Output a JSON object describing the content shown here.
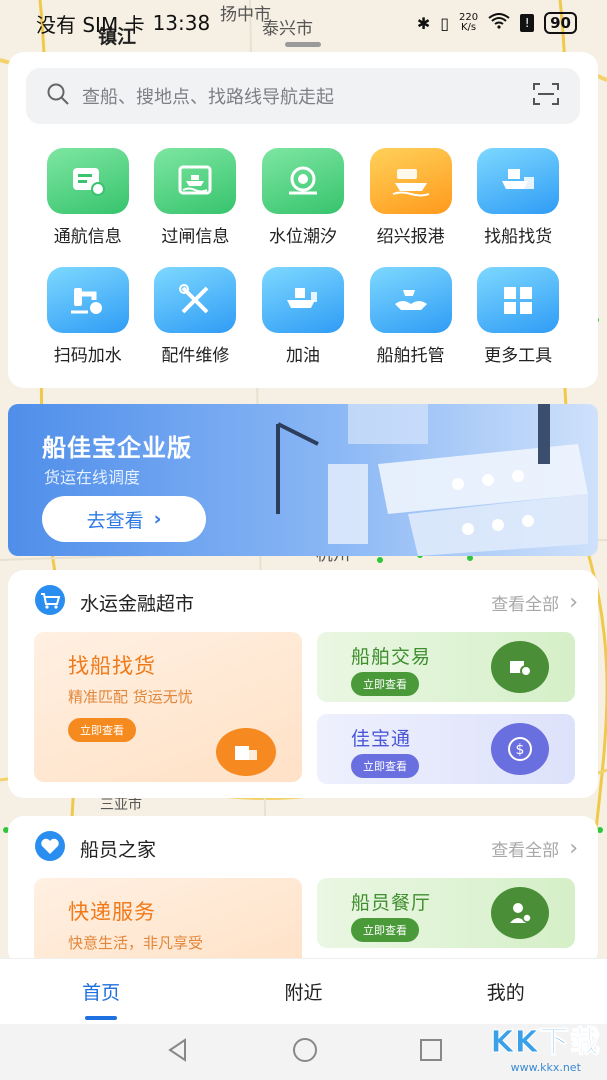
{
  "status_bar": {
    "carrier": "没有 SIM 卡",
    "time": "13:38",
    "speed_value": "220",
    "speed_unit": "K/s",
    "battery": "90"
  },
  "map": {
    "labels": [
      "扬中市",
      "泰兴市",
      "镇江",
      "杭州",
      "三亚市"
    ]
  },
  "search": {
    "placeholder": "查船、搜地点、找路线导航走起"
  },
  "tools": [
    {
      "label": "通航信息",
      "icon": "notice-board-icon",
      "color": "green"
    },
    {
      "label": "过闸信息",
      "icon": "ship-lock-icon",
      "color": "green"
    },
    {
      "label": "水位潮汐",
      "icon": "water-level-icon",
      "color": "green"
    },
    {
      "label": "绍兴报港",
      "icon": "port-report-icon",
      "color": "orange"
    },
    {
      "label": "找船找货",
      "icon": "cargo-ship-icon",
      "color": "blue"
    },
    {
      "label": "扫码加水",
      "icon": "water-tap-icon",
      "color": "blue"
    },
    {
      "label": "配件维修",
      "icon": "repair-tools-icon",
      "color": "blue"
    },
    {
      "label": "加油",
      "icon": "fuel-ship-icon",
      "color": "blue"
    },
    {
      "label": "船舶托管",
      "icon": "ship-custody-icon",
      "color": "blue"
    },
    {
      "label": "更多工具",
      "icon": "grid-more-icon",
      "color": "blue"
    }
  ],
  "banner": {
    "title": "船佳宝企业版",
    "subtitle": "货运在线调度",
    "button": "去查看"
  },
  "finance": {
    "title": "水运金融超市",
    "more": "查看全部",
    "big": {
      "title": "找船找货",
      "subtitle": "精准匹配 货运无忧",
      "action": "立即查看"
    },
    "cards": [
      {
        "title": "船舶交易",
        "action": "立即查看"
      },
      {
        "title": "佳宝通",
        "action": "立即查看"
      }
    ]
  },
  "crew": {
    "title": "船员之家",
    "more": "查看全部",
    "big": {
      "title": "快递服务",
      "subtitle": "快意生活，非凡享受"
    },
    "cards": [
      {
        "title": "船员餐厅",
        "action": "立即查看"
      }
    ]
  },
  "bottom_nav": [
    "首页",
    "附近",
    "我的"
  ],
  "watermark": {
    "brand": "KK下载",
    "url": "www.kkx.net"
  }
}
